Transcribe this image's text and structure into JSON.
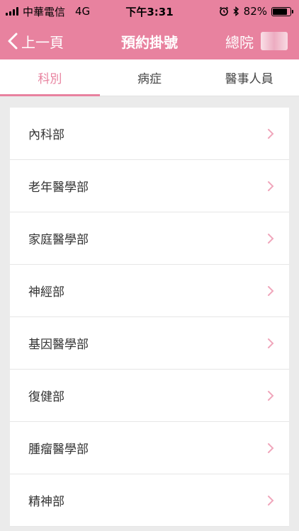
{
  "status_bar": {
    "carrier": "中華電信",
    "network": "4G",
    "time": "下午3:31",
    "battery_text": "82%",
    "battery_level": 0.82
  },
  "nav": {
    "back_label": "上一頁",
    "title": "預約掛號",
    "branch": "總院"
  },
  "tabs": [
    {
      "label": "科別",
      "active": true
    },
    {
      "label": "病症",
      "active": false
    },
    {
      "label": "醫事人員",
      "active": false
    }
  ],
  "departments": [
    "內科部",
    "老年醫學部",
    "家庭醫學部",
    "神經部",
    "基因醫學部",
    "復健部",
    "腫瘤醫學部",
    "精神部"
  ],
  "colors": {
    "brand": "#e8829f",
    "background": "#ebebeb",
    "chevron": "#f0a6bb"
  }
}
